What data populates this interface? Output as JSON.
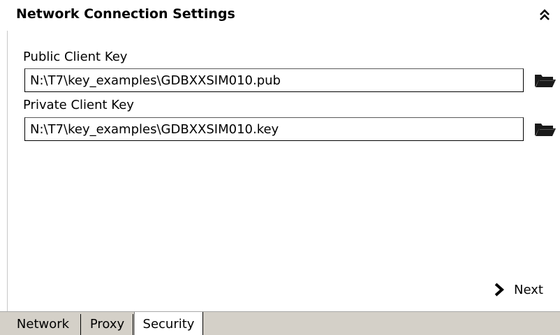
{
  "header": {
    "title": "Network Connection Settings",
    "collapse_icon": "double-chevron-up-icon"
  },
  "fields": {
    "public_key": {
      "label": "Public Client Key",
      "value": "N:\\T7\\key_examples\\GDBXXSIM010.pub",
      "browse_icon": "folder-open-icon"
    },
    "private_key": {
      "label": "Private Client Key",
      "value": "N:\\T7\\key_examples\\GDBXXSIM010.key",
      "browse_icon": "folder-open-icon"
    }
  },
  "navigation": {
    "next_label": "Next",
    "next_icon": "arrow-right-icon"
  },
  "tabs": [
    {
      "label": "Network",
      "active": false
    },
    {
      "label": "Proxy",
      "active": false
    },
    {
      "label": "Security",
      "active": true
    }
  ],
  "colors": {
    "tab_strip_background": "#d4d0c8",
    "active_tab_background": "#ffffff",
    "border": "#000000"
  }
}
